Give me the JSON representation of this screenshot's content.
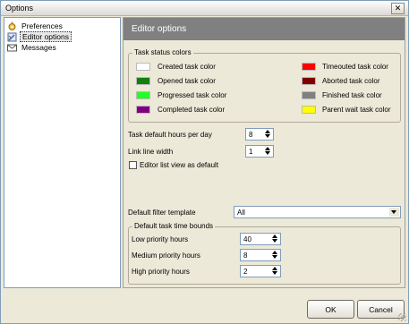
{
  "window": {
    "title": "Options",
    "close_glyph": "✕"
  },
  "nav": {
    "items": [
      {
        "label": "Preferences",
        "icon": "preferences-icon",
        "selected": false
      },
      {
        "label": "Editor options",
        "icon": "editor-options-icon",
        "selected": true
      },
      {
        "label": "Messages",
        "icon": "messages-icon",
        "selected": false
      }
    ]
  },
  "pane": {
    "title": "Editor options"
  },
  "task_status_colors": {
    "title": "Task status colors",
    "left": [
      {
        "label": "Created task color",
        "color": "#ffffff"
      },
      {
        "label": "Opened task color",
        "color": "#108010"
      },
      {
        "label": "Progressed task color",
        "color": "#22ff22"
      },
      {
        "label": "Completed task color",
        "color": "#800080"
      }
    ],
    "right": [
      {
        "label": "Timeouted task color",
        "color": "#ff0000"
      },
      {
        "label": "Aborted task color",
        "color": "#800000"
      },
      {
        "label": "Finished task color",
        "color": "#808080"
      },
      {
        "label": "Parent wait task color",
        "color": "#ffff00"
      }
    ]
  },
  "settings": {
    "hours_per_day_label": "Task default hours per day",
    "hours_per_day_value": "8",
    "link_width_label": "Link line width",
    "link_width_value": "1",
    "list_view_label": "Editor list view as default",
    "list_view_checked": false
  },
  "filter": {
    "label": "Default filter template",
    "value": "All"
  },
  "time_bounds": {
    "title": "Default task time bounds",
    "rows": [
      {
        "label": "Low priority hours",
        "value": "40"
      },
      {
        "label": "Medium priority hours",
        "value": "8"
      },
      {
        "label": "High priority hours",
        "value": "2"
      }
    ]
  },
  "buttons": {
    "ok": "OK",
    "cancel": "Cancel"
  }
}
